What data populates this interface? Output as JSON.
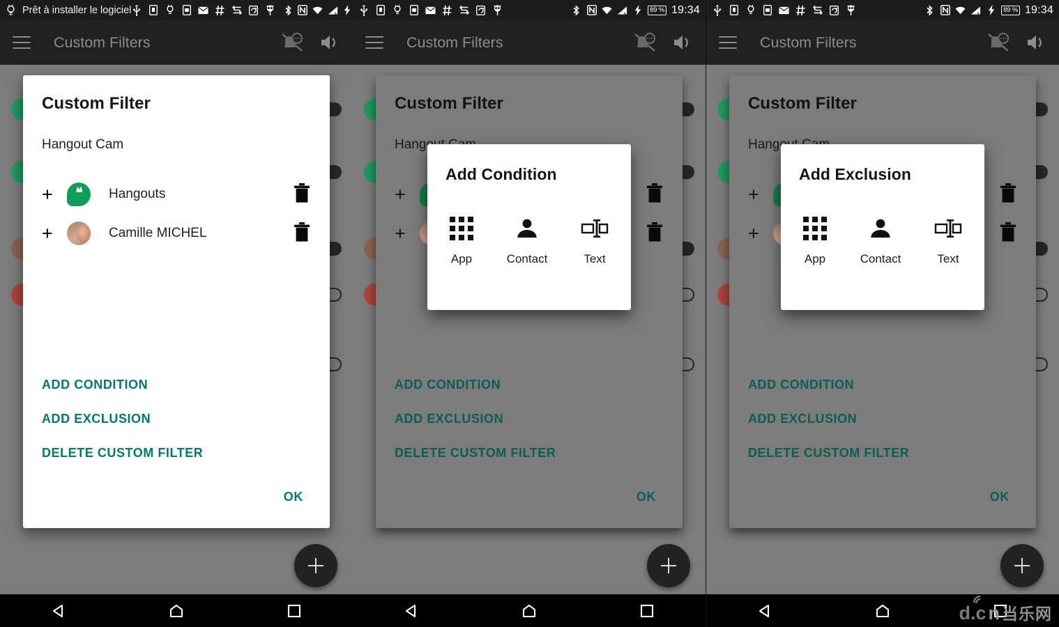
{
  "status_bar": {
    "ticker": "Prêt à installer le logiciel",
    "ticker_icon": "bulb-icon",
    "left_icons": [
      "usb-icon",
      "sd-card-icon",
      "bulb-icon",
      "sim-card-icon",
      "mail-icon",
      "hash-icon",
      "sync-icon",
      "screenshot-icon",
      "owl-icon"
    ],
    "right_icons": [
      "bluetooth-icon",
      "nfc-icon",
      "wifi-icon",
      "signal-icon",
      "charging-icon"
    ],
    "battery": "89 %",
    "time": "19:34"
  },
  "app_bar": {
    "title": "Custom Filters",
    "menu_icon": "hamburger-menu-icon",
    "actions": [
      "notifications-off-icon",
      "volume-up-icon"
    ]
  },
  "dialog": {
    "title": "Custom Filter",
    "subtitle": "Hangout Cam",
    "rows": [
      {
        "add_symbol": "+",
        "icon": "hangouts-app-icon",
        "label": "Hangouts",
        "delete_icon": "trash-icon"
      },
      {
        "add_symbol": "+",
        "icon": "contact-avatar",
        "label": "Camille MICHEL",
        "delete_icon": "trash-icon"
      }
    ],
    "actions": [
      "ADD CONDITION",
      "ADD EXCLUSION",
      "DELETE CUSTOM FILTER"
    ],
    "ok_label": "OK"
  },
  "popups": {
    "condition": {
      "title": "Add Condition",
      "options": [
        {
          "icon": "apps-grid-icon",
          "label": "App"
        },
        {
          "icon": "person-icon",
          "label": "Contact"
        },
        {
          "icon": "text-field-icon",
          "label": "Text"
        }
      ]
    },
    "exclusion": {
      "title": "Add Exclusion",
      "options": [
        {
          "icon": "apps-grid-icon",
          "label": "App"
        },
        {
          "icon": "person-icon",
          "label": "Contact"
        },
        {
          "icon": "text-field-icon",
          "label": "Text"
        }
      ]
    }
  },
  "fab": {
    "icon": "plus-icon",
    "label": "+"
  },
  "nav_bar": {
    "back": "back-triangle-icon",
    "home": "home-icon",
    "recents": "recents-square-icon"
  },
  "watermark": {
    "d": "d.c",
    "cn": "n",
    "han": "当乐网"
  },
  "colors": {
    "accent_teal": "#00796B",
    "hangouts_green": "#0F9D58",
    "app_bar_bg": "#212121",
    "dim_overlay": "#7C7C7C"
  }
}
